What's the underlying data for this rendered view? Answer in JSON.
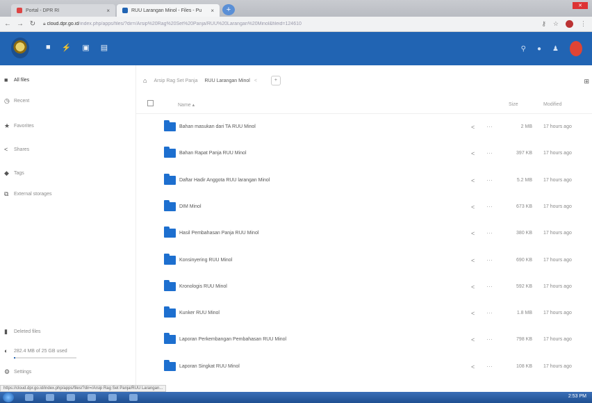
{
  "browser": {
    "tab1_title": "Portal - DPR RI",
    "tab2_title": "RUU Larangan Minol - Files - Pu",
    "url_host": "cloud.dpr.go.id",
    "url_path": "/index.php/apps/files/?dir=/Arsip%20Rag%20Set%20Panja/RUU%20Larangan%20Minol&fileid=124610",
    "status_url": "https://cloud.dpr.go.id/index.php/apps/files/?dir=/Arsip Rag Set Panja/RUU Larangan..."
  },
  "sidebar": {
    "items": [
      {
        "label": "All files",
        "icon": "folder-icon"
      },
      {
        "label": "Recent",
        "icon": "clock-icon"
      },
      {
        "label": "Favorites",
        "icon": "star-icon"
      },
      {
        "label": "Shares",
        "icon": "share-icon"
      },
      {
        "label": "Tags",
        "icon": "tag-icon"
      },
      {
        "label": "External storages",
        "icon": "external-storage-icon"
      }
    ],
    "bottom": {
      "deleted": "Deleted files",
      "quota": "282.4 MB of 25 GB used",
      "quota_fraction": 0.011,
      "settings": "Settings"
    }
  },
  "breadcrumb": {
    "parent": "Arsip Rag Set Panja",
    "current": "RUU Larangan Minol"
  },
  "table": {
    "headers": {
      "name": "Name",
      "size": "Size",
      "modified": "Modified"
    },
    "rows": [
      {
        "name": "Bahan masukan dari TA RUU Minol",
        "size": "2 MB",
        "modified": "17 hours ago"
      },
      {
        "name": "Bahan Rapat Panja RUU Minol",
        "size": "397 KB",
        "modified": "17 hours ago"
      },
      {
        "name": "Daftar Hadir Anggota RUU larangan Minol",
        "size": "5.2 MB",
        "modified": "17 hours ago"
      },
      {
        "name": "DIM Minol",
        "size": "673 KB",
        "modified": "17 hours ago"
      },
      {
        "name": "Hasil Pembahasan Panja RUU Minol",
        "size": "380 KB",
        "modified": "17 hours ago"
      },
      {
        "name": "Konsinyering RUU Minol",
        "size": "690 KB",
        "modified": "17 hours ago"
      },
      {
        "name": "Kronologis RUU Minol",
        "size": "592 KB",
        "modified": "17 hours ago"
      },
      {
        "name": "Kunker RUU Minol",
        "size": "1.8 MB",
        "modified": "17 hours ago"
      },
      {
        "name": "Laporan Perkembangan Pembahasan RUU Minol",
        "size": "798 KB",
        "modified": "17 hours ago"
      },
      {
        "name": "Laporan Singkat RUU Minol",
        "size": "108 KB",
        "modified": "17 hours ago"
      }
    ]
  },
  "taskbar": {
    "clock": "2:53 PM"
  },
  "colors": {
    "header": "#2164b3",
    "folder": "#1d6fcf",
    "avatar": "#e04434"
  }
}
